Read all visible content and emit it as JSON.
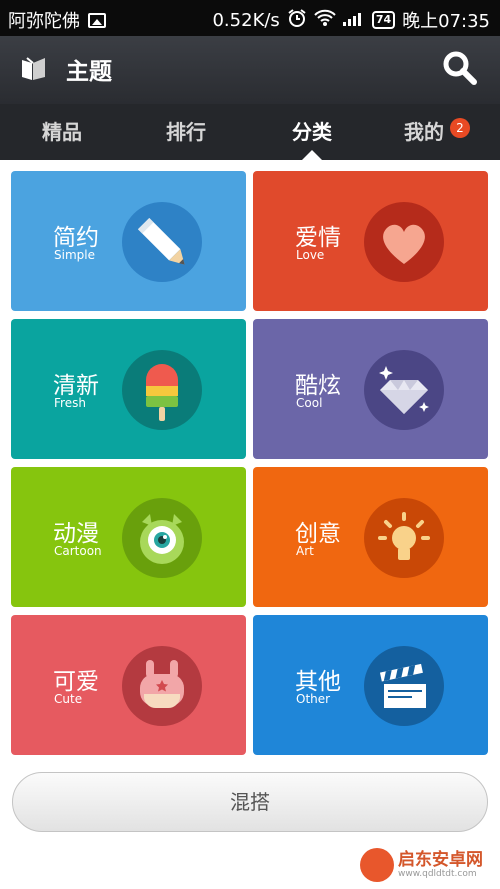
{
  "status_bar": {
    "carrier": "阿弥陀佛",
    "speed": "0.52K/s",
    "battery": "74",
    "time": "晚上07:35"
  },
  "header": {
    "title": "主题"
  },
  "tabs": [
    {
      "label": "精品"
    },
    {
      "label": "排行"
    },
    {
      "label": "分类",
      "active": true
    },
    {
      "label": "我的",
      "badge": "2"
    }
  ],
  "categories": [
    {
      "zh": "简约",
      "en": "Simple",
      "color": "#4ba3e0",
      "circle": "#2e82c6",
      "icon": "pencil-icon"
    },
    {
      "zh": "爱情",
      "en": "Love",
      "color": "#e04a2c",
      "circle": "#b52b1b",
      "icon": "heart-icon"
    },
    {
      "zh": "清新",
      "en": "Fresh",
      "color": "#0aa49f",
      "circle": "#0a7c79",
      "icon": "popsicle-icon"
    },
    {
      "zh": "酷炫",
      "en": "Cool",
      "color": "#6b66a8",
      "circle": "#4b4685",
      "icon": "diamond-icon"
    },
    {
      "zh": "动漫",
      "en": "Cartoon",
      "color": "#86c50e",
      "circle": "#69a00c",
      "icon": "monster-eye-icon"
    },
    {
      "zh": "创意",
      "en": "Art",
      "color": "#f06710",
      "circle": "#c94806",
      "icon": "lightbulb-icon"
    },
    {
      "zh": "可爱",
      "en": "Cute",
      "color": "#e65a60",
      "circle": "#b43a40",
      "icon": "cute-bunny-icon"
    },
    {
      "zh": "其他",
      "en": "Other",
      "color": "#1f86d8",
      "circle": "#14609f",
      "icon": "clapperboard-icon"
    }
  ],
  "mix_button": "混搭",
  "watermark": {
    "name": "启东安卓网",
    "url": "www.qdldtdt.com"
  }
}
